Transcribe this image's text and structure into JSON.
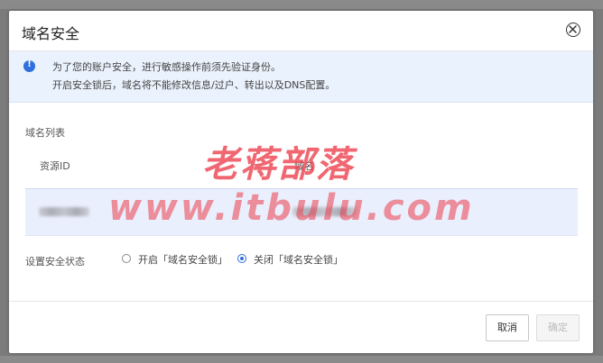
{
  "dialog": {
    "title": "域名安全",
    "close_icon": "close-circle-icon"
  },
  "alert": {
    "icon": "info-icon",
    "color": "#2f6fde",
    "line1": "为了您的账户安全，进行敏感操作前须先验证身份。",
    "line2": "开启安全锁后，域名将不能修改信息/过户、转出以及DNS配置。"
  },
  "domain_list": {
    "label": "域名列表",
    "columns": [
      "资源ID",
      "域名"
    ]
  },
  "status": {
    "label": "设置安全状态",
    "options": [
      {
        "label": "开启「域名安全锁」",
        "checked": false
      },
      {
        "label": "关闭「域名安全锁」",
        "checked": true
      }
    ]
  },
  "footer": {
    "cancel_label": "取消",
    "ok_label": "确定",
    "ok_disabled": true
  },
  "watermark": {
    "line1": "老蒋部落",
    "line2": "www.itbulu.com"
  }
}
